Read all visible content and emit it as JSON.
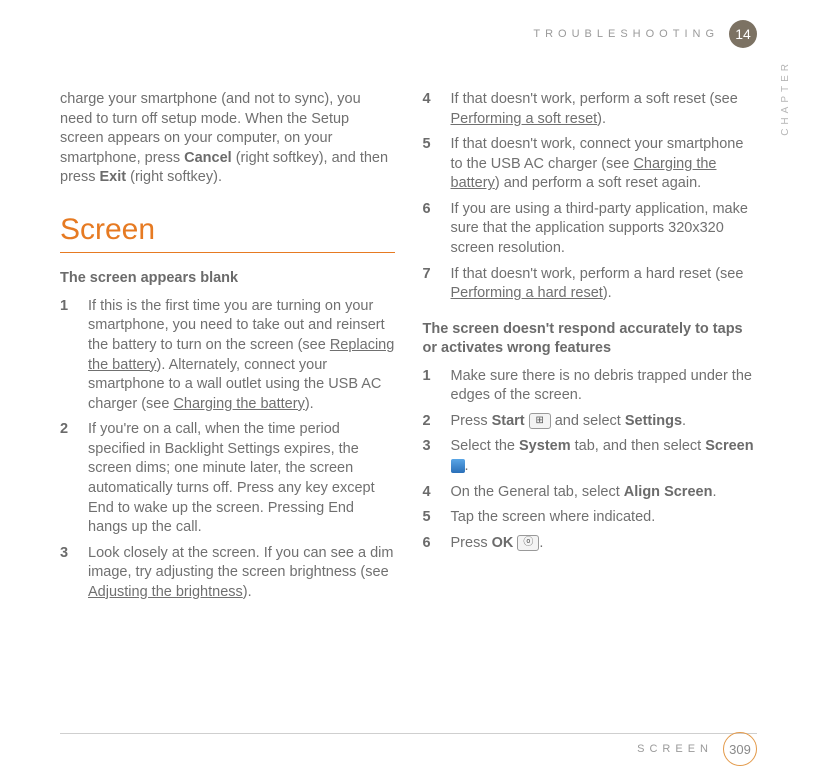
{
  "header": {
    "section": "TROUBLESHOOTING",
    "chapter_number": "14",
    "chapter_label": "CHAPTER"
  },
  "footer": {
    "section": "SCREEN",
    "page": "309"
  },
  "intro": {
    "pre": "charge your smartphone (and not to sync), you need to turn off setup mode. When the Setup screen appears on your computer, on your smartphone, press ",
    "b1": "Cancel",
    "mid": " (right softkey), and then press ",
    "b2": "Exit",
    "post": " (right softkey)."
  },
  "section_title": "Screen",
  "sub1": "The screen appears blank",
  "s1_1a": "If this is the first time you are turning on your smartphone, you need to take out and reinsert the battery to turn on the screen (see ",
  "s1_1_link1": "Replacing the battery",
  "s1_1b": "). Alternately, connect your smartphone to a wall outlet using the USB AC charger (see ",
  "s1_1_link2": "Charging the battery",
  "s1_1c": ").",
  "s1_2": "If you're on a call, when the time period specified in Backlight Settings expires, the screen dims; one minute later, the screen automatically turns off. Press any key except End to wake up the screen. Pressing End hangs up the call.",
  "s1_3a": "Look closely at the screen. If you can see a dim image, try adjusting the screen brightness (see ",
  "s1_3_link": "Adjusting the brightness",
  "s1_3b": ").",
  "s1_4a": "If that doesn't work, perform a soft reset (see ",
  "s1_4_link": "Performing a soft reset",
  "s1_4b": ").",
  "s1_5a": "If that doesn't work, connect your smartphone to the USB AC charger (see ",
  "s1_5_link": "Charging the battery",
  "s1_5b": ") and perform a soft reset again.",
  "s1_6": "If you are using a third-party application, make sure that the application supports 320x320 screen resolution.",
  "s1_7a": "If that doesn't work, perform a hard reset (see ",
  "s1_7_link": "Performing a hard reset",
  "s1_7b": ").",
  "sub2": "The screen doesn't respond accurately to taps or activates wrong features",
  "s2_1": "Make sure there is no debris trapped under the edges of the screen.",
  "s2_2a": "Press ",
  "s2_2_b1": "Start",
  "s2_2b": " and select ",
  "s2_2_b2": "Settings",
  "s2_2c": ".",
  "s2_3a": "Select the ",
  "s2_3_b1": "System",
  "s2_3b": " tab, and then select ",
  "s2_3_b2": "Screen",
  "s2_3c": ".",
  "s2_4a": "On the General tab, select ",
  "s2_4_b": "Align Screen",
  "s2_4b": ".",
  "s2_5": "Tap the screen where indicated.",
  "s2_6a": "Press ",
  "s2_6_b": "OK",
  "s2_6b": "."
}
